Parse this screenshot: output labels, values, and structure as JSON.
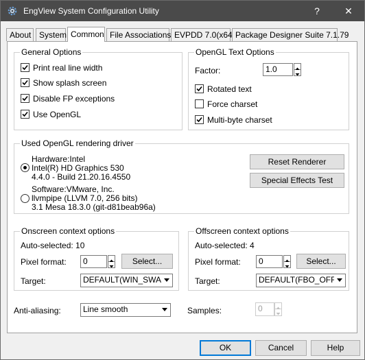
{
  "window": {
    "title": "EngView System Configuration Utility",
    "help_glyph": "?",
    "close_glyph": "✕"
  },
  "tabs": [
    {
      "label": "About",
      "active": false
    },
    {
      "label": "System",
      "active": false
    },
    {
      "label": "Common",
      "active": true
    },
    {
      "label": "File Associations",
      "active": false
    },
    {
      "label": "EVPDD 7.0(x64)",
      "active": false
    },
    {
      "label": "Package Designer Suite 7.1.79",
      "active": false
    }
  ],
  "general_options": {
    "title": "General Options",
    "items": [
      {
        "label": "Print real line width",
        "checked": true
      },
      {
        "label": "Show splash screen",
        "checked": true
      },
      {
        "label": "Disable FP exceptions",
        "checked": true
      },
      {
        "label": "Use OpenGL",
        "checked": true
      }
    ]
  },
  "opengl_text": {
    "title": "OpenGL Text Options",
    "factor_label": "Factor:",
    "factor_value": "1.0",
    "items": [
      {
        "label": "Rotated text",
        "checked": true
      },
      {
        "label": "Force charset",
        "checked": false
      },
      {
        "label": "Multi-byte charset",
        "checked": true
      }
    ]
  },
  "driver": {
    "title": "Used OpenGL rendering driver",
    "hardware": {
      "selected": true,
      "lines": [
        "Hardware:Intel",
        "Intel(R) HD Graphics 530",
        "4.4.0 - Build 21.20.16.4550"
      ]
    },
    "software": {
      "selected": false,
      "lines": [
        "Software:VMware, Inc.",
        "llvmpipe (LLVM 7.0, 256 bits)",
        "3.1 Mesa 18.3.0 (git-d81beab96a)"
      ]
    },
    "reset_label": "Reset Renderer",
    "special_label": "Special Effects Test"
  },
  "onscreen": {
    "title": "Onscreen context options",
    "auto": "Auto-selected: 10",
    "pixel_label": "Pixel format:",
    "pixel_value": "0",
    "select_label": "Select...",
    "target_label": "Target:",
    "target_value": "DEFAULT(WIN_SWAP"
  },
  "offscreen": {
    "title": "Offscreen context options",
    "auto": "Auto-selected: 4",
    "pixel_label": "Pixel format:",
    "pixel_value": "0",
    "select_label": "Select...",
    "target_label": "Target:",
    "target_value": "DEFAULT(FBO_OFFSC"
  },
  "antialiasing": {
    "label": "Anti-aliasing:",
    "value": "Line smooth"
  },
  "samples": {
    "label": "Samples:",
    "value": "0",
    "disabled": true
  },
  "buttons": {
    "ok": "OK",
    "cancel": "Cancel",
    "help": "Help"
  },
  "colors": {
    "titlebar": "#4a4a4a",
    "default_button_border": "#0078d7",
    "dialog_bg": "#f0f0f0"
  },
  "icons": {
    "app": "gear-icon",
    "help": "question-mark-icon",
    "close": "close-icon"
  }
}
